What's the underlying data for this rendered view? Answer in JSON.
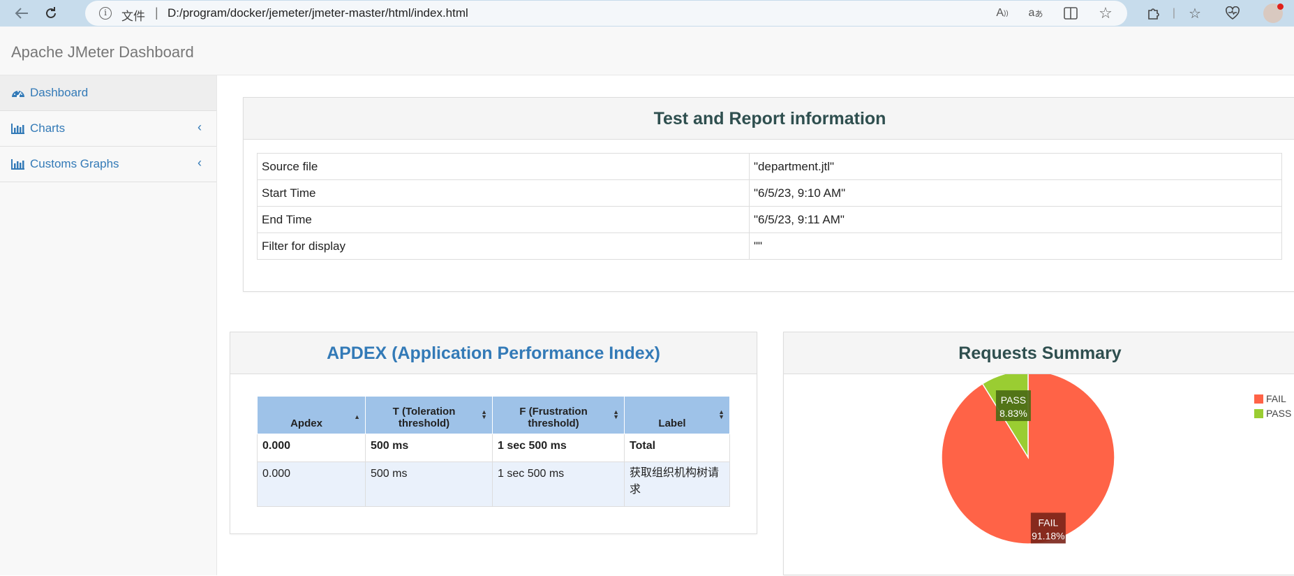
{
  "browser": {
    "address_label": "文件",
    "separator": "|",
    "url": "D:/program/docker/jemeter/jmeter-master/html/index.html",
    "icons": [
      "back-icon",
      "refresh-icon",
      "info-icon",
      "read-aloud-icon",
      "translate-icon",
      "split-screen-icon",
      "favorite-star-icon",
      "extensions-icon",
      "favorites-list-icon",
      "browser-essentials-icon",
      "profile-avatar"
    ]
  },
  "app": {
    "title": "Apache JMeter Dashboard"
  },
  "sidebar": {
    "items": [
      {
        "label": "Dashboard",
        "icon": "dashboard-gauge-icon"
      },
      {
        "label": "Charts",
        "icon": "bar-chart-icon"
      },
      {
        "label": "Customs Graphs",
        "icon": "bar-chart-icon"
      }
    ]
  },
  "test_info": {
    "title": "Test and Report information",
    "rows": [
      {
        "key": "Source file",
        "value": "\"department.jtl\""
      },
      {
        "key": "Start Time",
        "value": "\"6/5/23, 9:10 AM\""
      },
      {
        "key": "End Time",
        "value": "\"6/5/23, 9:11 AM\""
      },
      {
        "key": "Filter for display",
        "value": "\"\""
      }
    ]
  },
  "apdex": {
    "title": "APDEX (Application Performance Index)",
    "headers": [
      "Apdex",
      "T (Toleration threshold)",
      "F (Frustration threshold)",
      "Label"
    ],
    "rows": [
      [
        "0.000",
        "500 ms",
        "1 sec 500 ms",
        "Total"
      ],
      [
        "0.000",
        "500 ms",
        "1 sec 500 ms",
        "获取组织机构树请求"
      ]
    ]
  },
  "requests_summary": {
    "title": "Requests Summary",
    "colors": {
      "FAIL": "#ff6347",
      "PASS": "#9acd32"
    }
  },
  "chart_data": {
    "type": "pie",
    "title": "Requests Summary",
    "labels": [
      "FAIL",
      "PASS"
    ],
    "values": [
      91.18,
      8.83
    ],
    "value_labels": [
      "91.18%",
      "8.83%"
    ],
    "legend": "top-right"
  }
}
